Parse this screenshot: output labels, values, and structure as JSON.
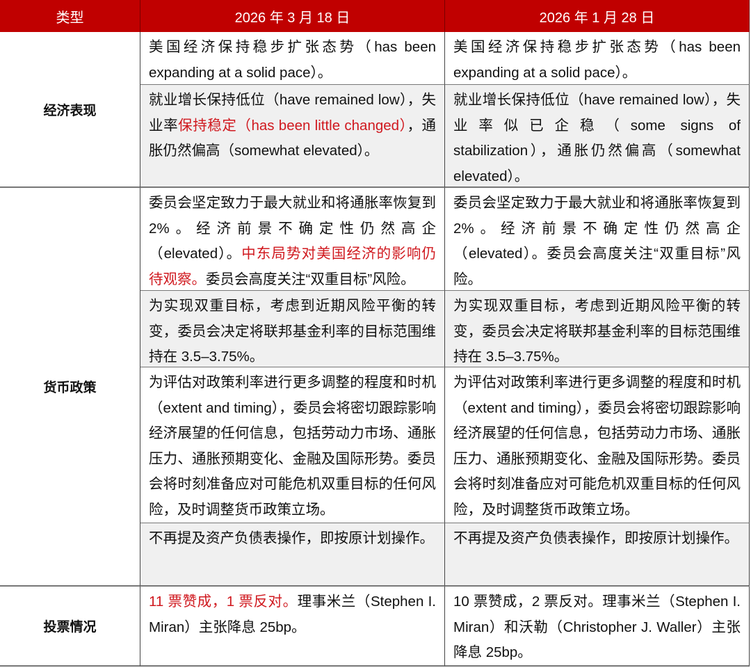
{
  "header": {
    "type": "类型",
    "col_a": "2026 年 3 月 18 日",
    "col_b": "2026 年 1 月 28 日"
  },
  "colors": {
    "header_bg": "#c00000",
    "highlight": "#d0191f"
  },
  "categories": [
    "经济表现",
    "货币政策",
    "投票情况"
  ],
  "rows": [
    {
      "a": [
        {
          "t": "美国经济保持稳步扩张态势（has been expanding at a solid pace）。"
        }
      ],
      "b": [
        {
          "t": "美国经济保持稳步扩张态势（has been expanding at a solid pace）。"
        }
      ]
    },
    {
      "a": [
        {
          "t": "就业增长保持低位（have remained low），失业率"
        },
        {
          "t": "保持稳定（has been little changed）",
          "red": true
        },
        {
          "t": "，通胀仍然偏高（somewhat elevated）。"
        }
      ],
      "b": [
        {
          "t": "就业增长保持低位（have remained low），失业率似已企稳（some signs of stabilization），通胀仍然偏高（somewhat elevated）。"
        }
      ]
    },
    {
      "a": [
        {
          "t": "委员会坚定致力于最大就业和将通胀率恢复到 2%。经济前景不确定性仍然高企（elevated）。"
        },
        {
          "t": "中东局势对美国经济的影响仍待观察。",
          "red": true
        },
        {
          "t": "委员会高度关注“双重目标”风险。"
        }
      ],
      "b": [
        {
          "t": "委员会坚定致力于最大就业和将通胀率恢复到 2%。经济前景不确定性仍然高企（elevated）。委员会高度关注“双重目标”风险。"
        }
      ]
    },
    {
      "a": [
        {
          "t": "为实现双重目标，考虑到近期风险平衡的转变，委员会决定将联邦基金利率的目标范围维持在 3.5–3.75%。"
        }
      ],
      "b": [
        {
          "t": "为实现双重目标，考虑到近期风险平衡的转变，委员会决定将联邦基金利率的目标范围维持在 3.5–3.75%。"
        }
      ]
    },
    {
      "a": [
        {
          "t": "为评估对政策利率进行更多调整的程度和时机（extent and timing），委员会将密切跟踪影响经济展望的任何信息，包括劳动力市场、通胀压力、通胀预期变化、金融及国际形势。委员会将时刻准备应对可能危机双重目标的任何风险，及时调整货币政策立场。"
        }
      ],
      "b": [
        {
          "t": "为评估对政策利率进行更多调整的程度和时机（extent and timing），委员会将密切跟踪影响经济展望的任何信息，包括劳动力市场、通胀压力、通胀预期变化、金融及国际形势。委员会将时刻准备应对可能危机双重目标的任何风险，及时调整货币政策立场。"
        }
      ]
    },
    {
      "a": [
        {
          "t": "不再提及资产负债表操作，即按原计划操作。"
        }
      ],
      "b": [
        {
          "t": "不再提及资产负债表操作，即按原计划操作。"
        }
      ]
    },
    {
      "a": [
        {
          "t": "11 票赞成，1 票反对。",
          "red": true
        },
        {
          "t": "理事米兰（Stephen I. Miran）主张降息 25bp。"
        }
      ],
      "b": [
        {
          "t": "10 票赞成，2 票反对。理事米兰（Stephen I. Miran）和沃勒（Christopher J. Waller）主张降息 25bp。"
        }
      ]
    }
  ]
}
